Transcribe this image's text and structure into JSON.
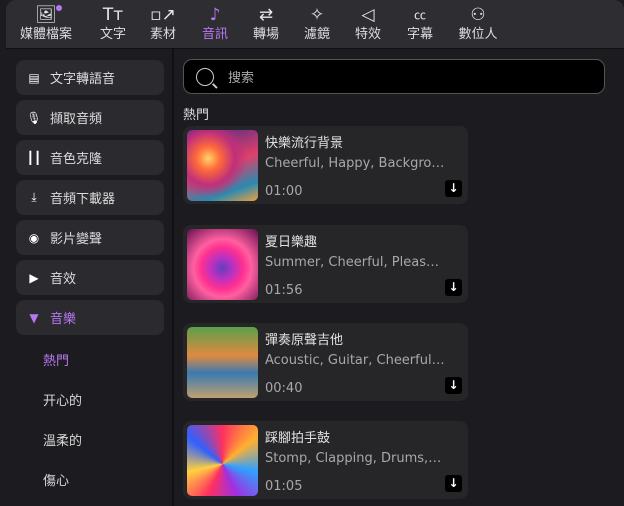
{
  "tabs": [
    {
      "label": "媒體檔案",
      "icon": "media-icon"
    },
    {
      "label": "文字",
      "icon": "text-icon"
    },
    {
      "label": "素材",
      "icon": "elements-icon"
    },
    {
      "label": "音訊",
      "icon": "music-note-icon",
      "active": true
    },
    {
      "label": "轉場",
      "icon": "transition-icon"
    },
    {
      "label": "濾鏡",
      "icon": "filter-sparkle-icon"
    },
    {
      "label": "特效",
      "icon": "effects-icon"
    },
    {
      "label": "字幕",
      "icon": "captions-icon"
    },
    {
      "label": "數位人",
      "icon": "avatar-icon"
    }
  ],
  "sidebar": {
    "items": [
      {
        "label": "文字轉語音",
        "icon": "tts-icon"
      },
      {
        "label": "擷取音頻",
        "icon": "microphone-icon"
      },
      {
        "label": "音色克隆",
        "icon": "waveform-icon"
      },
      {
        "label": "音頻下載器",
        "icon": "download-box-icon"
      },
      {
        "label": "影片變聲",
        "icon": "voice-changer-icon"
      },
      {
        "label": "音效",
        "icon": "caret-right-icon"
      },
      {
        "label": "音樂",
        "icon": "caret-down-icon"
      }
    ],
    "subitems": [
      "熱門",
      "开心的",
      "溫柔的",
      "傷心"
    ]
  },
  "search": {
    "placeholder": "搜索"
  },
  "section_title": "熱門",
  "tracks": [
    {
      "title": "快樂流行背景",
      "tags": "Cheerful, Happy, Background",
      "duration": "01:00"
    },
    {
      "title": "夏日樂趣",
      "tags": "Summer, Cheerful, Pleasure",
      "duration": "01:56"
    },
    {
      "title": "彈奏原聲吉他",
      "tags": "Acoustic, Guitar, Cheerful, Happy",
      "duration": "00:40"
    },
    {
      "title": "踩腳拍手鼓",
      "tags": "Stomp, Clapping, Drums, Cheerful",
      "duration": "01:05"
    }
  ],
  "accent": "#b678f0"
}
